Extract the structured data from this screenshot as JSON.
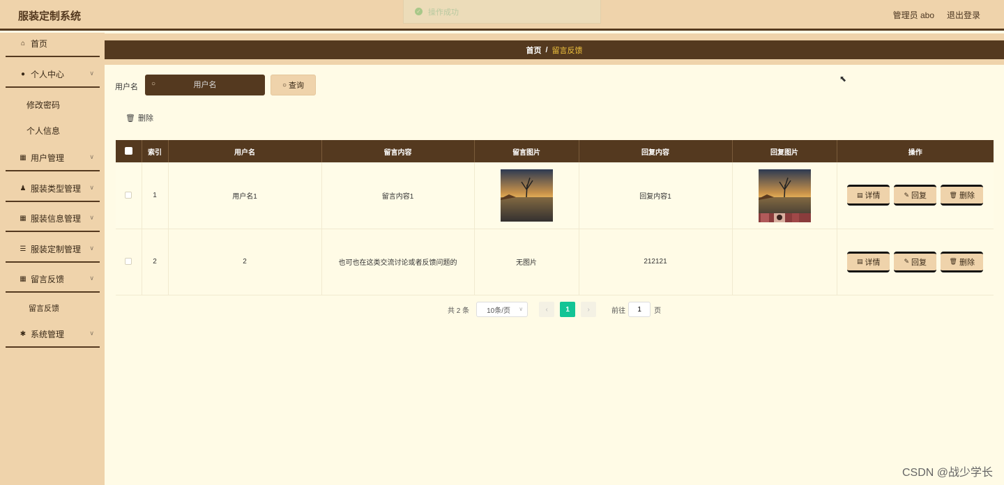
{
  "header": {
    "app_title": "服装定制系统",
    "user": "管理员 abo",
    "logout": "退出登录",
    "toast": "操作成功"
  },
  "sidebar": {
    "items": [
      {
        "label": "首页",
        "icon": "home-icon"
      },
      {
        "label": "个人中心",
        "icon": "user-icon",
        "children": [
          "修改密码",
          "个人信息"
        ]
      },
      {
        "label": "用户管理",
        "icon": "grid-icon"
      },
      {
        "label": "服装类型管理",
        "icon": "person-icon"
      },
      {
        "label": "服装信息管理",
        "icon": "grid-icon"
      },
      {
        "label": "服装定制管理",
        "icon": "list-icon"
      },
      {
        "label": "留言反馈",
        "icon": "grid-icon",
        "children": [
          "留言反馈"
        ]
      },
      {
        "label": "系统管理",
        "icon": "settings-icon"
      }
    ]
  },
  "breadcrumb": {
    "home": "首页",
    "separator": "/",
    "current": "留言反馈"
  },
  "search": {
    "label": "用户名",
    "placeholder": "用户名",
    "button": "查询"
  },
  "toolbar": {
    "delete": "删除"
  },
  "table": {
    "headers": [
      "索引",
      "用户名",
      "留言内容",
      "留言图片",
      "回复内容",
      "回复图片",
      "操作"
    ],
    "rows": [
      {
        "index": "1",
        "username": "用户名1",
        "content": "留言内容1",
        "image": "photo",
        "reply": "回复内容1",
        "reply_image": "photo"
      },
      {
        "index": "2",
        "username": "2",
        "content": "也可也在这类交流讨论或者反馈问题的",
        "image_text": "无图片",
        "reply": "212121",
        "reply_image": "strip"
      }
    ],
    "actions": {
      "detail": "详情",
      "reply": "回复",
      "delete": "删除"
    }
  },
  "pagination": {
    "total": "共 2 条",
    "page_size": "10条/页",
    "current": "1",
    "goto": "前往",
    "goto_value": "1",
    "page_unit": "页"
  },
  "watermark": "CSDN @战少学长"
}
